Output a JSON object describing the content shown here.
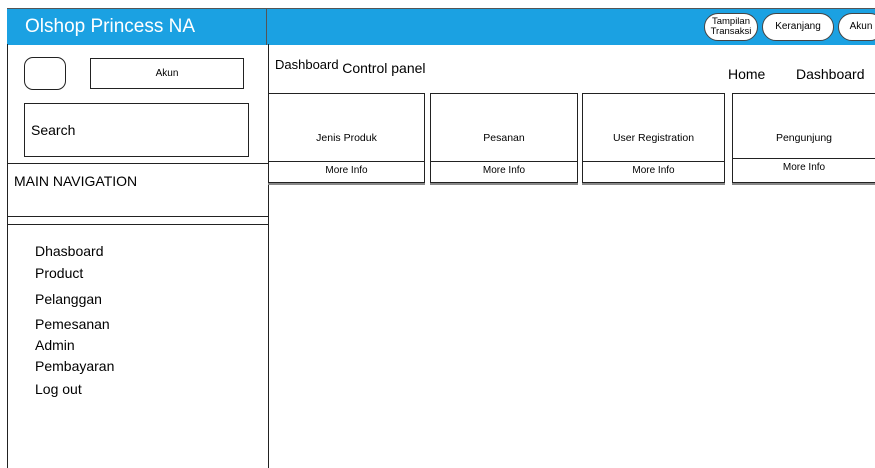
{
  "header": {
    "brand": "Olshop Princess NA",
    "buttons": {
      "tampilan_line1": "Tampilan",
      "tampilan_line2": "Transaksi",
      "keranjang": "Keranjang",
      "akun": "Akun"
    },
    "color": "#1ba1e2"
  },
  "sidebar": {
    "akun_label": "Akun",
    "search_label": "Search",
    "nav_title": "MAIN NAVIGATION",
    "items": [
      "Dhasboard",
      "Product",
      "Pelanggan",
      "Pemesanan",
      "Admin",
      "Pembayaran",
      "Log out"
    ]
  },
  "content": {
    "title": "Dashboard",
    "subtitle": "Control panel",
    "breadcrumb": [
      "Home",
      "Dashboard"
    ],
    "boxes": [
      {
        "label": "Jenis Produk",
        "more": "More Info"
      },
      {
        "label": "Pesanan",
        "more": "More Info"
      },
      {
        "label": "User Registration",
        "more": "More Info"
      },
      {
        "label": "Pengunjung",
        "more": "More Info"
      }
    ]
  }
}
